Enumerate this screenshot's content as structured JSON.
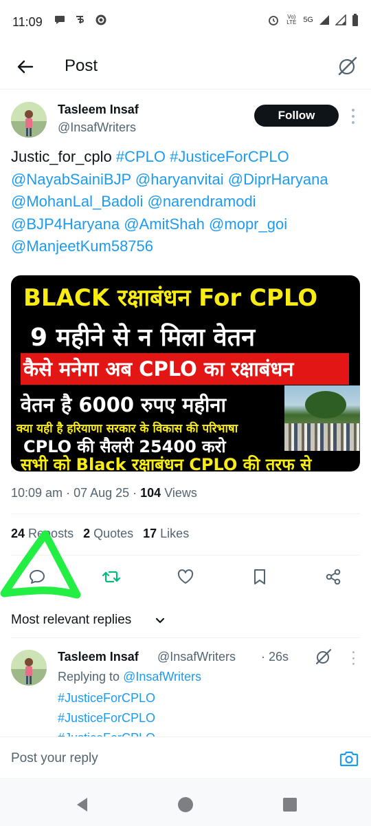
{
  "status_bar": {
    "time": "11:09",
    "left_icons": [
      "chat-bubble-icon",
      "pe-app-icon",
      "whatsapp-icon"
    ],
    "network_label": "Vo) LTE",
    "network_type": "5G"
  },
  "header": {
    "title": "Post"
  },
  "author": {
    "name": "Tasleem Insaf",
    "handle": "@InsafWriters",
    "follow_label": "Follow"
  },
  "post": {
    "lead_text": "Justic_for_cplo ",
    "tag_1": "#CPLO",
    "tag_2": "#JusticeForCPLO",
    "mention_1": "@NayabSainiBJP",
    "mention_2": "@haryanvitai",
    "mention_3": "@DiprHaryana",
    "mention_4": "@MohanLal_Badoli",
    "mention_5": "@narendramodi",
    "mention_6": "@BJP4Haryana",
    "mention_7": "@AmitShah",
    "mention_8": "@mopr_goi",
    "mention_9": "@ManjeetKum58756"
  },
  "media": {
    "line_1": "BLACK रक्षाबंधन For CPLO",
    "line_2": "9 महीने से न मिला वेतन",
    "line_3": "कैसे मनेगा अब CPLO का रक्षाबंधन",
    "line_4": "वेतन है 6000 रुपए महीना",
    "line_5": "क्या यही है हरियाणा सरकार के विकास की परिभाषा",
    "line_6": "CPLO की सैलरी 25400 करो",
    "line_7": "सभी को Black रक्षाबंधन CPLO की तरफ से",
    "colors": {
      "yellow": "#f8ec12",
      "red_banner": "#e31616",
      "background": "#000000"
    }
  },
  "meta": {
    "time": "10:09 am",
    "sep": " · ",
    "date": "07 Aug 25",
    "views_count": "104",
    "views_label": " Views"
  },
  "stats": {
    "reposts_count": "24",
    "reposts_label": " Reposts",
    "quotes_count": "2",
    "quotes_label": " Quotes",
    "likes_count": "17",
    "likes_label": " Likes"
  },
  "actions": [
    "reply-icon",
    "repost-icon",
    "like-icon",
    "bookmark-icon",
    "share-icon"
  ],
  "annotation_color": "#22ee44",
  "replies": {
    "sort_label": "Most relevant replies",
    "items": [
      {
        "name": "Tasleem Insaf",
        "handle": "@InsafWriters",
        "time": " · 26s",
        "replying_prefix": "Replying to ",
        "replying_to": "@InsafWriters",
        "tags": [
          "#JusticeForCPLO",
          "#JusticeForCPLO",
          "#JusticeForCPLO"
        ]
      }
    ]
  },
  "composer": {
    "placeholder": "Post your reply"
  },
  "colors": {
    "accent": "#1d9bf0",
    "text": "#0f1419",
    "muted": "#536471"
  }
}
